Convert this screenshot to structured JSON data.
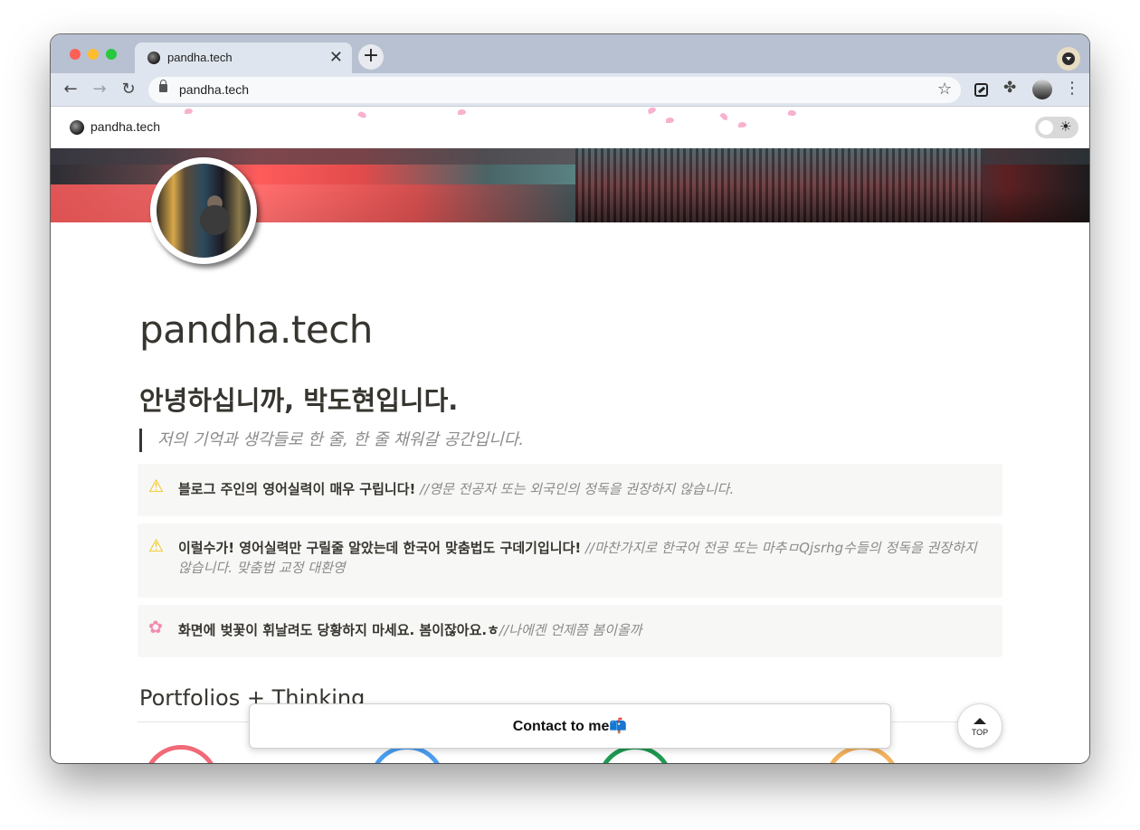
{
  "browser": {
    "tab_title": "pandha.tech",
    "tab_close": "✕",
    "new_tab": "+",
    "back": "←",
    "forward": "→",
    "reload": "↻",
    "url": "pandha.tech",
    "bookmark": "☆",
    "extensions": "✤",
    "menu": "⋮"
  },
  "site": {
    "name": "pandha.tech",
    "theme_icon": "☀"
  },
  "content": {
    "title": "pandha.tech",
    "greeting": "안녕하십니까, 박도현입니다.",
    "quote": "저의 기억과 생각들로 한 줄, 한 줄 채워갈 공간입니다.",
    "callouts": [
      {
        "icon": "⚠",
        "bold": "블로그 주인의 영어실력이 매우 구립니다!",
        "italic": "//영문 전공자 또는 외국인의 정독을 권장하지 않습니다."
      },
      {
        "icon": "⚠",
        "bold": "이럴수가! 영어실력만 구릴줄 알았는데 한국어 맞춤법도 구데기입니다!",
        "italic": "//마찬가지로 한국어 전공 또는 마추ㅁQjsrhg수들의 정독을 권장하지 않습니다. 맞춤법 교정 대환영"
      },
      {
        "icon": "✿",
        "bold": "화면에 벚꽃이 휘날려도 당황하지 마세요. 봄이잖아요.ㅎ",
        "italic": "//나에겐 언제쯤 봄이올까"
      }
    ],
    "section_heading": "Portfolios + Thinking"
  },
  "contact": {
    "label": "Contact to me📫"
  },
  "top_button": {
    "label": "TOP"
  },
  "colors": {
    "ring_1": "#f06a77",
    "ring_2": "#4a9ef0",
    "ring_3": "#1e9a52",
    "ring_4": "#f3b25e",
    "tab_strip": "#b7c1d1",
    "toolbar": "#dfe5ee"
  }
}
